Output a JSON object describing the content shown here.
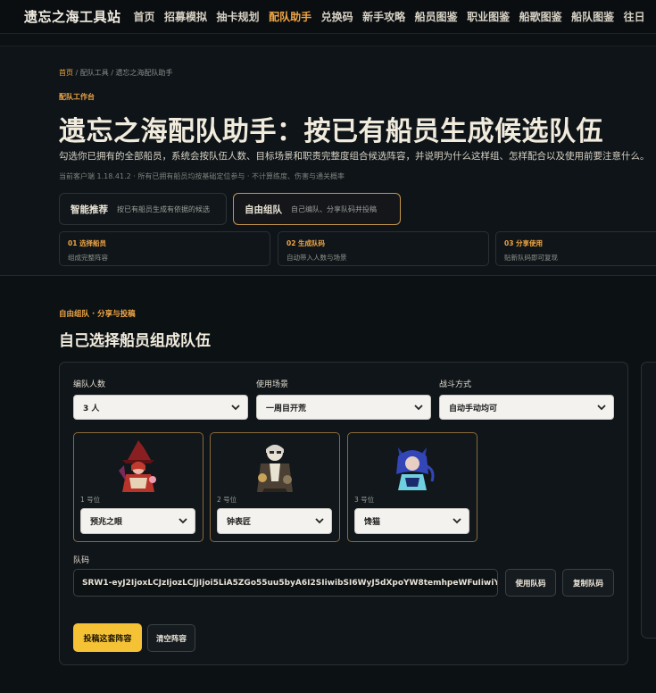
{
  "nav": {
    "brand": "遗忘之海工具站",
    "links": [
      {
        "label": "首页"
      },
      {
        "label": "招募模拟"
      },
      {
        "label": "抽卡规划"
      },
      {
        "label": "配队助手"
      },
      {
        "label": "兑换码"
      },
      {
        "label": "新手攻略"
      },
      {
        "label": "船员图鉴"
      },
      {
        "label": "职业图鉴"
      },
      {
        "label": "船歌图鉴"
      },
      {
        "label": "船队图鉴"
      },
      {
        "label": "往日"
      }
    ],
    "active_index": 3
  },
  "hero": {
    "breadcrumb_home": "首页",
    "breadcrumb_rest": " / 配队工具 / 遗忘之海配队助手",
    "kicker": "配队工作台",
    "title": "遗忘之海配队助手：按已有船员生成候选队伍",
    "description": "勾选你已拥有的全部船员，系统会按队伍人数、目标场景和职责完整度组合候选阵容，并说明为什么这样组、怎样配合以及使用前要注意什么。",
    "meta": "当前客户端 1.18.41.2 · 所有已拥有船员均按基础定位参与 · 不计算练度、伤害与通关概率"
  },
  "modes": [
    {
      "name": "智能推荐",
      "desc": "按已有船员生成有依据的候选"
    },
    {
      "name": "自由组队",
      "desc": "自己编队、分享队码并投稿"
    }
  ],
  "active_mode": 1,
  "steps": [
    {
      "name": "01 选择船员",
      "desc": "组成完整阵容"
    },
    {
      "name": "02 生成队码",
      "desc": "自动带入人数与场景"
    },
    {
      "name": "03 分享使用",
      "desc": "贴新队码即可复现"
    }
  ],
  "section": {
    "kicker": "自由组队 · 分享与投稿",
    "title": "自己选择船员组成队伍"
  },
  "form": {
    "size_label": "编队人数",
    "size_value": "3 人",
    "scene_label": "使用场景",
    "scene_value": "一周目开荒",
    "battle_label": "战斗方式",
    "battle_value": "自动手动均可"
  },
  "slots": [
    {
      "pos": "1 号位",
      "member": "预兆之眼",
      "icon": "witch-portrait"
    },
    {
      "pos": "2 号位",
      "member": "钟表匠",
      "icon": "clockmaker-portrait"
    },
    {
      "pos": "3 号位",
      "member": "馋猫",
      "icon": "catgirl-portrait"
    }
  ],
  "code": {
    "label": "队码",
    "value": "SRW1-eyJ2IjoxLCJzIjozLCJjIjoi5LiA5ZGo55uu5byA6I2SIiwibSI6WyJ5dXpoYW8temhpeWFuIiwiY2xvY2t",
    "use_label": "使用队码",
    "copy_label": "复制队码"
  },
  "actions": {
    "submit_label": "投稿这套阵容",
    "clear_label": "清空阵容"
  },
  "colors": {
    "accent": "#f0a646",
    "button_gold": "#f4c234",
    "background": "#0c1114"
  }
}
